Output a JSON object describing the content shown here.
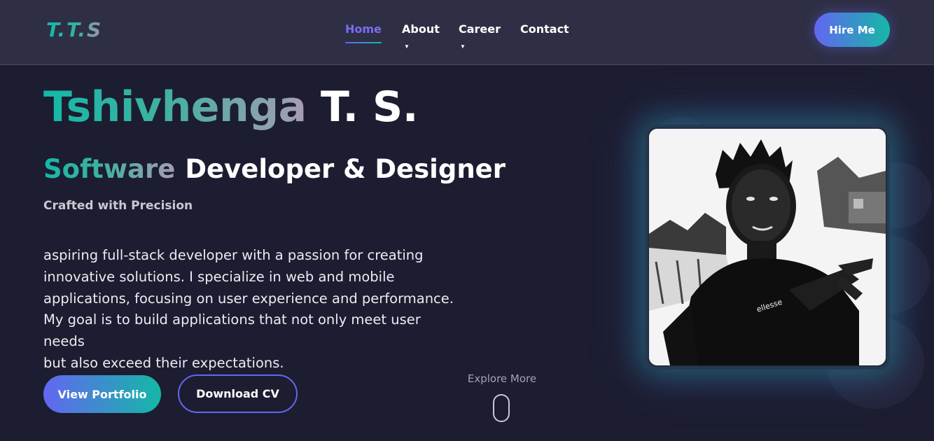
{
  "nav": {
    "logo": "T.T.S",
    "links": [
      {
        "label": "Home",
        "active": true
      },
      {
        "label": "About",
        "active": false,
        "has_dropdown": true
      },
      {
        "label": "Career",
        "active": false,
        "has_dropdown": true
      },
      {
        "label": "Contact",
        "active": false
      }
    ],
    "hire_label": "Hire Me"
  },
  "hero": {
    "name_first": "Tshivhenga",
    "name_rest": "T. S.",
    "role_first": "Software",
    "role_rest": "Developer & Designer",
    "tagline": "Crafted with Precision",
    "bio_lines": [
      "aspiring full-stack developer with a passion for creating",
      "innovative solutions. I specialize in web and mobile",
      "applications, focusing on user experience and performance.",
      "My goal is to build applications that not only meet user needs",
      "but also exceed their expectations."
    ],
    "portfolio_label": "View Portfolio",
    "cv_label": "Download CV",
    "explore_label": "Explore More",
    "photo_shirt_text": "ellesse"
  },
  "icons": {
    "scroll": "mouse-scroll-icon",
    "caret": "caret-down-icon"
  },
  "colors": {
    "background": "#1c1d30",
    "navbar": "#2e2f45",
    "accent_purple": "#6366f1",
    "accent_teal": "#14b8a6",
    "active_link": "#7c6cf2"
  }
}
